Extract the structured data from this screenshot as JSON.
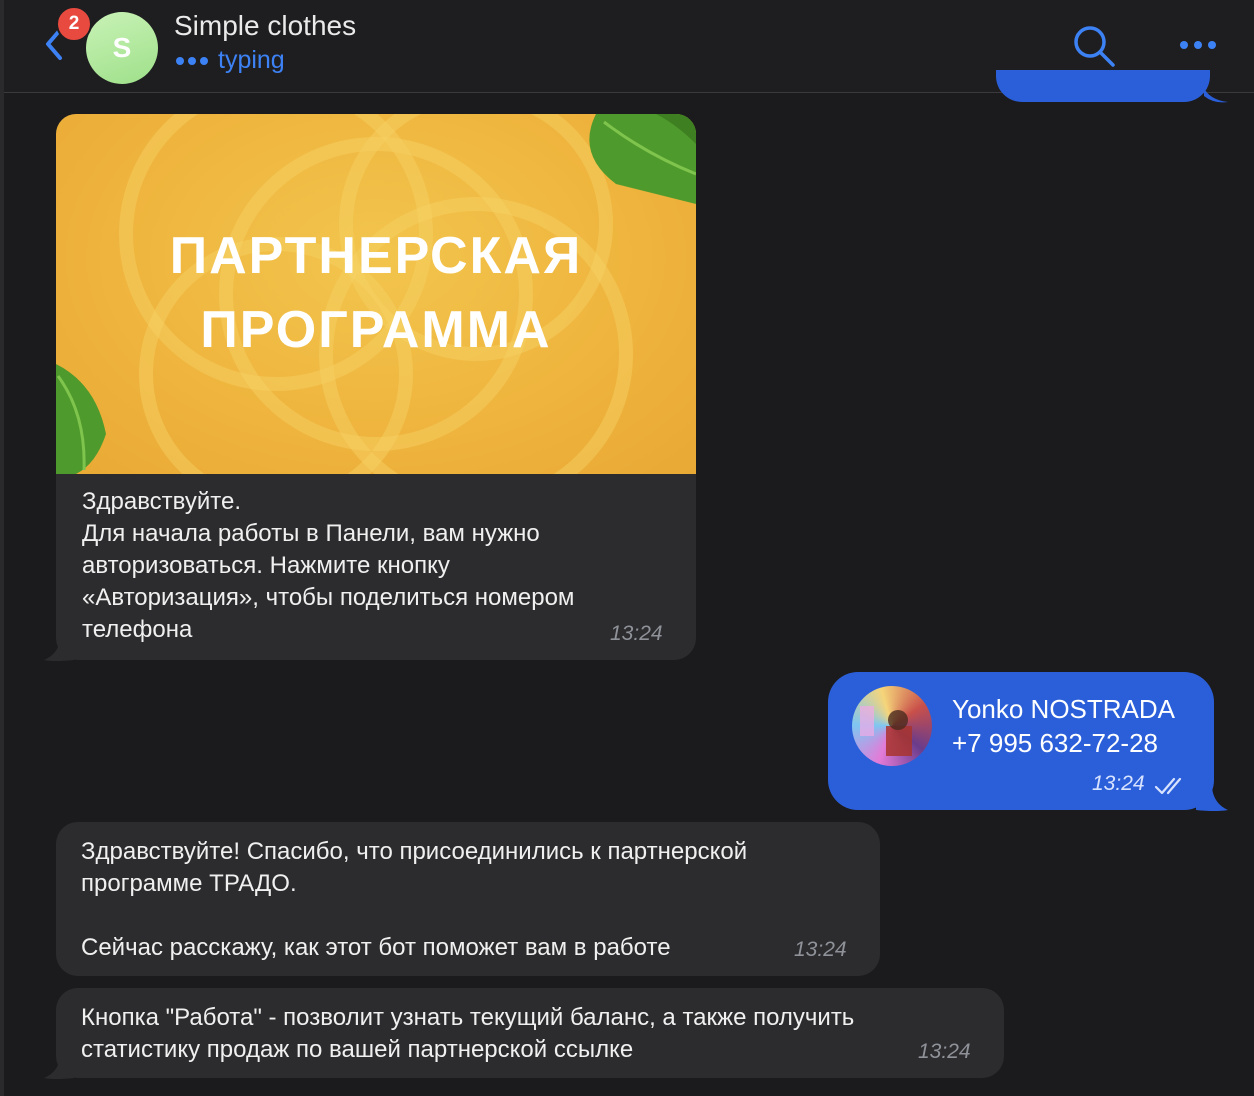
{
  "header": {
    "back_label": "Back",
    "unread_badge": "2",
    "avatar_letter": "S",
    "title": "Simple clothes",
    "status": "typing",
    "accent_color": "#3d82f5"
  },
  "messages": [
    {
      "direction": "incoming",
      "image_title_line1": "ПАРТНЕРСКАЯ",
      "image_title_line2": "ПРОГРАММА",
      "text": "Здравствуйте.\nДля начала работы в Панели, вам нужно\nавторизоваться. Нажмите кнопку\n«Авторизация», чтобы поделиться номером\nтелефона",
      "time": "13:24"
    },
    {
      "direction": "outgoing",
      "type": "contact",
      "contact_name": "Yonko NOSTRADA",
      "contact_phone": "+7 995 632-72-28",
      "time": "13:24",
      "status_icon": "double-check-icon"
    },
    {
      "direction": "incoming",
      "text": "Здравствуйте! Спасибо, что присоединились к партнерской\nпрограмме ТРАДО.\n\nСейчас расскажу, как этот бот поможет вам в работе",
      "time": "13:24"
    },
    {
      "direction": "incoming",
      "text": "Кнопка \"Работа\" - позволит узнать текущий баланс, а также получить\nстатистику продаж по вашей партнерской ссылке",
      "time": "13:24"
    }
  ],
  "colors": {
    "background": "#1b1b1d",
    "incoming_bubble": "#2c2c2e",
    "outgoing_bubble": "#2b5fd9",
    "badge": "#e84a3f"
  }
}
